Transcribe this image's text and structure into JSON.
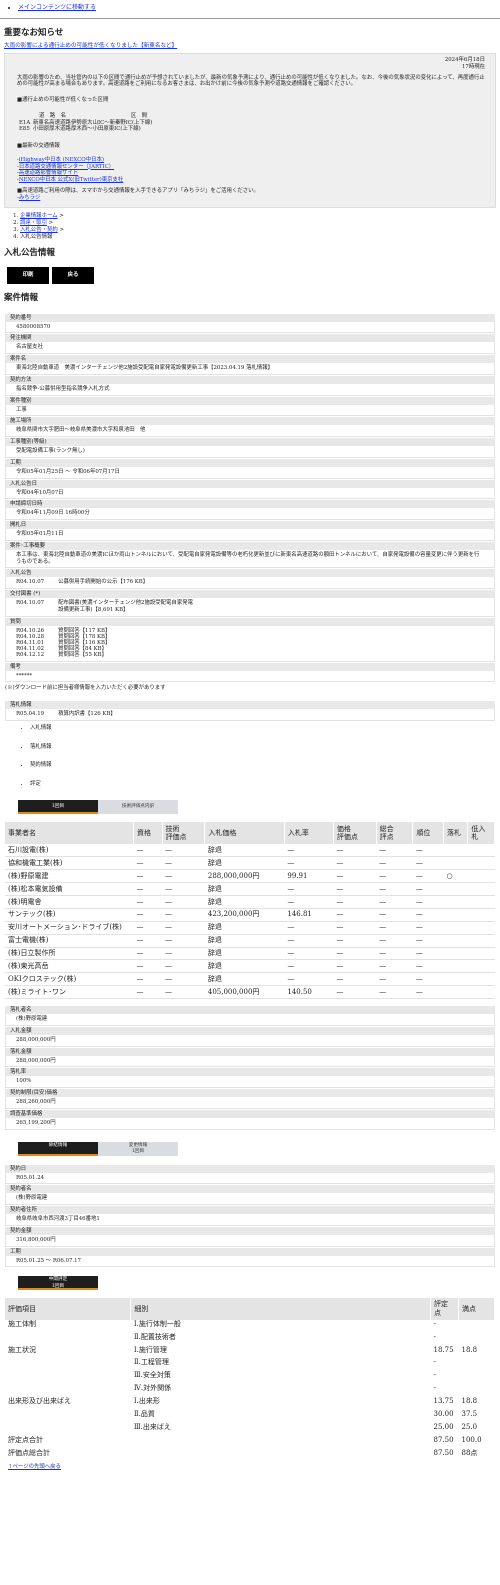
{
  "skip_link": "メインコンテンツに移動する",
  "notice": {
    "heading": "重要なお知らせ",
    "link": "大雨の影響による通行止めの可能性が低くなりました【新東名など】",
    "date": "2024年6月18日",
    "time": "17時現在",
    "body": "大雨の影響のため、当社管内の以下の区間で通行止めが予想されていましたが、最新の気象予測により、通行止めの可能性が低くなりました。なお、今後の気象状況の変化によって、再度通行止めの可能性が高まる場合もあります。高速道路をご利用になるお客さまは、お出かけ前に今後の気象予測や道路交通情報をご確認ください。",
    "section1": "■通行止めの可能性が低くなった区間",
    "col_road": "道　路　名",
    "col_section": "区　間",
    "roads": [
      {
        "code": "E1A",
        "name": "新東名高速道路",
        "section": "伊勢原大山IC～新秦野IC(上下線)"
      },
      {
        "code": "E85",
        "name": "小田原厚木道路",
        "section": "厚木西～小田原東IC(上下線)"
      }
    ],
    "section2": "■最新の交通情報",
    "traffic_links": [
      "iHighway中日本 (NEXCO中日本)",
      "日本道路交通情報センター（JARTIC）",
      "高速道路影響情報サイト",
      "NEXCO中日本 公式X(旧Twitter)東京支社"
    ],
    "app_note": "■高速道路ご利用の際は、スマホから交通情報を入手できるアプリ「みちラジ」をご活用ください。",
    "app_link": "みちラジ"
  },
  "breadcrumb": [
    {
      "label": "企業情報ホーム",
      "link": true
    },
    {
      "label": "調達・取引",
      "link": true
    },
    {
      "label": "入札公告・契約",
      "link": true
    },
    {
      "label": "入札公告情報",
      "link": false
    }
  ],
  "page_title": "入札公告情報",
  "buttons": {
    "print": "印刷",
    "back": "戻る"
  },
  "case_heading": "案件情報",
  "fields": [
    {
      "label": "契約番号",
      "value": "4580008570"
    },
    {
      "label": "発注機関",
      "value": "名古屋支社"
    },
    {
      "label": "案件名",
      "value": "東海北陸自動車道　美濃インターチェンジ他2施設受配電自家発電設備更新工事【2023.04.19 落札情報】"
    },
    {
      "label": "契約方法",
      "value": "指名競争-公募併用型指名競争入札方式"
    },
    {
      "label": "案件種別",
      "value": "工事"
    },
    {
      "label": "施工場所",
      "value": "岐阜県関市大字肥田～岐阜県美濃市大字和泉池田　他"
    },
    {
      "label": "工事種別(等級)",
      "value": "受配電設備工事(ランク無し)"
    },
    {
      "label": "工期",
      "value": "令和05年01月25日 〜 令和06年07月17日"
    },
    {
      "label": "入札公告日",
      "value": "令和04年10月07日"
    },
    {
      "label": "申請締切日時",
      "value": "令和04年11月09日 16時00分"
    },
    {
      "label": "開札日",
      "value": "令和05年01月11日"
    },
    {
      "label": "案件･工事概要",
      "value": "本工事は、東海北陸自動車道の美濃ICほか両山トンネルにおいて、受配電自家発電設備等の老朽化更新並びに新東名高速道路の額田トンネルにおいて、自家発電設備の容量変更に伴う更新を行うものである。"
    }
  ],
  "koukoku": {
    "label": "入札公告",
    "date": "R04.10.07",
    "text": "公募併用手続開始の公示【176 KB】"
  },
  "koufu": {
    "label": "交付図書 (*)",
    "date": "R04.10.07",
    "text1": "配布図書(美濃インターチェンジ他2施設受配電自家発電",
    "text2": "設備更新工事)【8,691 KB】"
  },
  "shitsumon": {
    "label": "質問",
    "items": [
      {
        "date": "R04.10.26",
        "text": "質問回答【117 KB】"
      },
      {
        "date": "R04.10.28",
        "text": "質問回答【178 KB】"
      },
      {
        "date": "R04.11.01",
        "text": "質問回答【116 KB】"
      },
      {
        "date": "R04.11.02",
        "text": "質問回答【84 KB】"
      },
      {
        "date": "R04.12.12",
        "text": "質問回答【55 KB】"
      }
    ]
  },
  "bikou": {
    "label": "備考",
    "value": "******"
  },
  "dl_note": "(※)ダウンロード前に担当者様情報を入力いただく必要があります",
  "rakusatsu_info": {
    "label": "落札情報",
    "date": "R05.04.19",
    "text": "積算内訳書【126 KB】"
  },
  "sub_list": [
    "入札情報",
    "落札情報",
    "契約情報",
    "評定"
  ],
  "bid_tabs": [
    "1回目",
    "技術評価点内訳"
  ],
  "bid_headers": [
    "事業者名",
    "資格",
    "技術\n評価点",
    "入札価格",
    "入札率",
    "価格\n評価点",
    "総合\n評点",
    "順位",
    "落札",
    "低入\n札"
  ],
  "bid_rows": [
    [
      "石川設電(株)",
      "—",
      "—",
      "辞退",
      "—",
      "—",
      "—",
      "—",
      "",
      ""
    ],
    [
      "協和機電工業(株)",
      "—",
      "—",
      "辞退",
      "—",
      "—",
      "—",
      "—",
      "",
      ""
    ],
    [
      "(株)野原電建",
      "—",
      "—",
      "288,000,000円",
      "99.91",
      "—",
      "—",
      "—",
      "○",
      ""
    ],
    [
      "(株)松本電気設備",
      "—",
      "—",
      "辞退",
      "—",
      "—",
      "—",
      "—",
      "",
      ""
    ],
    [
      "(株)明電舎",
      "—",
      "—",
      "辞退",
      "—",
      "—",
      "—",
      "—",
      "",
      ""
    ],
    [
      "サンテック(株)",
      "—",
      "—",
      "423,200,000円",
      "146.81",
      "—",
      "—",
      "—",
      "",
      ""
    ],
    [
      "安川オートメーション･ドライブ(株)",
      "—",
      "—",
      "辞退",
      "—",
      "—",
      "—",
      "—",
      "",
      ""
    ],
    [
      "富士電機(株)",
      "—",
      "—",
      "辞退",
      "—",
      "—",
      "—",
      "—",
      "",
      ""
    ],
    [
      "(株)日立製作所",
      "—",
      "—",
      "辞退",
      "—",
      "—",
      "—",
      "—",
      "",
      ""
    ],
    [
      "(株)東光高岳",
      "—",
      "—",
      "辞退",
      "—",
      "—",
      "—",
      "—",
      "",
      ""
    ],
    [
      "OKIクロステック(株)",
      "—",
      "—",
      "辞退",
      "—",
      "—",
      "—",
      "—",
      "",
      ""
    ],
    [
      "(株)ミライト･ワン",
      "—",
      "—",
      "405,000,000円",
      "140.50",
      "—",
      "—",
      "—",
      "",
      ""
    ]
  ],
  "award_fields": [
    {
      "label": "落札者名",
      "value": "(株)野原電建"
    },
    {
      "label": "入札金額",
      "value": "288,000,000円"
    },
    {
      "label": "落札金額",
      "value": "288,000,000円"
    },
    {
      "label": "落札率",
      "value": "100%"
    },
    {
      "label": "契約制限(目安)価格",
      "value": "288,260,000円"
    },
    {
      "label": "調査基準価格",
      "value": "265,199,200円"
    }
  ],
  "contract_tabs": [
    "締結情報",
    "変更情報\n1回目"
  ],
  "contract_fields": [
    {
      "label": "契約日",
      "value": "R05.01.24"
    },
    {
      "label": "契約者名",
      "value": "(株)野原電建"
    },
    {
      "label": "契約者住所",
      "value": "岐阜県岐阜市西河渡3丁目46番地1"
    },
    {
      "label": "契約金額",
      "value": "316,800,000円"
    },
    {
      "label": "工期",
      "value": "R05.01.25 〜 R06.07.17"
    }
  ],
  "eval_tab": "中間評定\n1回目",
  "eval_headers": [
    "評価項目",
    "細別",
    "評定\n点",
    "満点"
  ],
  "eval_rows": [
    [
      "施工体制",
      "Ⅰ.施行体制一般",
      "-",
      ""
    ],
    [
      "",
      "Ⅱ.配置技術者",
      "-",
      ""
    ],
    [
      "施工状況",
      "Ⅰ.施行管理",
      "18.75",
      "18.8"
    ],
    [
      "",
      "Ⅱ.工程管理",
      "-",
      ""
    ],
    [
      "",
      "Ⅲ.安全対策",
      "-",
      ""
    ],
    [
      "",
      "Ⅳ.対外関係",
      "-",
      ""
    ],
    [
      "出来形及び出来ばえ",
      "Ⅰ.出来形",
      "13.75",
      "18.8"
    ],
    [
      "",
      "Ⅱ.品質",
      "30.00",
      "37.5"
    ],
    [
      "",
      "Ⅲ.出来ばえ",
      "25.00",
      "25.0"
    ],
    [
      "評定点合計",
      "",
      "87.50",
      "100.0"
    ],
    [
      "評価点総合計",
      "",
      "87.50",
      "88点"
    ]
  ],
  "page_top": "ページの先頭へ戻る"
}
